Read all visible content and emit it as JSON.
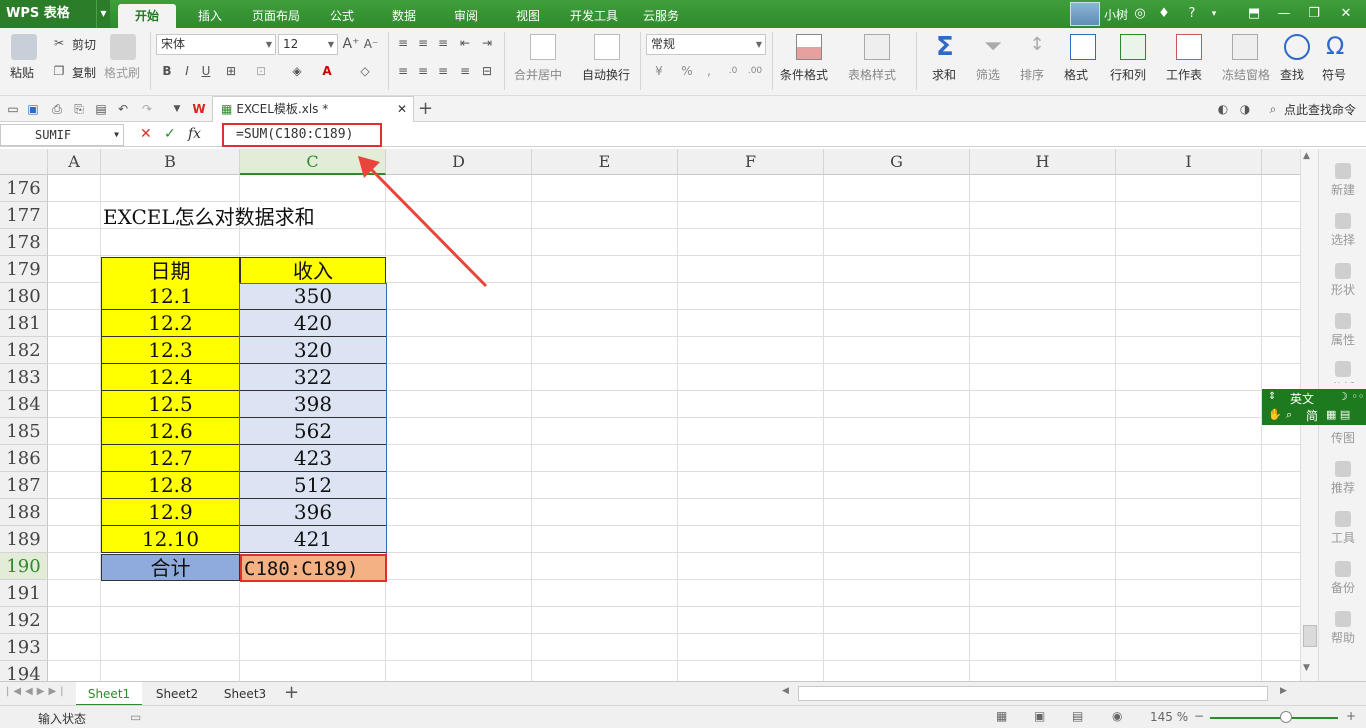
{
  "app": {
    "name": "WPS 表格"
  },
  "menu_tabs": [
    "开始",
    "插入",
    "页面布局",
    "公式",
    "数据",
    "审阅",
    "视图",
    "开发工具",
    "云服务"
  ],
  "user": {
    "name": "小树"
  },
  "ribbon": {
    "paste": "粘贴",
    "cut": "剪切",
    "copy": "复制",
    "format_painter": "格式刷",
    "font_name": "宋体",
    "font_size": "12",
    "merge_center": "合并居中",
    "wrap_text": "自动换行",
    "number_format": "常规",
    "percent": "%",
    "comma": ",",
    "conditional_format": "条件格式",
    "table_style": "表格样式",
    "sum": "求和",
    "filter": "筛选",
    "sort": "排序",
    "format": "格式",
    "rows_cols": "行和列",
    "worksheet": "工作表",
    "freeze": "冻结窗格",
    "find": "查找",
    "symbol": "符号",
    "bold": "B",
    "italic": "I",
    "underline": "U",
    "font_color_letter": "A"
  },
  "doc_tab": {
    "title": "EXCEL模板.xls *"
  },
  "search_cmd": "点此查找命令",
  "formula_bar": {
    "name_box": "SUMIF",
    "cancel": "✕",
    "confirm": "✓",
    "fx": "fx",
    "formula": "=SUM(C180:C189)"
  },
  "columns": [
    "A",
    "B",
    "C",
    "D",
    "E",
    "F",
    "G",
    "H",
    "I"
  ],
  "rows": [
    "176",
    "177",
    "178",
    "179",
    "180",
    "181",
    "182",
    "183",
    "184",
    "185",
    "186",
    "187",
    "188",
    "189",
    "190",
    "191",
    "192",
    "193",
    "194"
  ],
  "sheet": {
    "title": "EXCEL怎么对数据求和",
    "header_date": "日期",
    "header_income": "收入",
    "dates": [
      "12.1",
      "12.2",
      "12.3",
      "12.4",
      "12.5",
      "12.6",
      "12.7",
      "12.8",
      "12.9",
      "12.10"
    ],
    "income": [
      "350",
      "420",
      "320",
      "322",
      "398",
      "562",
      "423",
      "512",
      "396",
      "421"
    ],
    "total_label": "合计",
    "total_edit": "C180:C189)"
  },
  "side_panel": [
    "新建",
    "选择",
    "形状",
    "属性",
    "分析",
    "传图",
    "推荐",
    "工具",
    "备份",
    "帮助"
  ],
  "ime": {
    "lang": "英文",
    "mode": "简"
  },
  "sheet_tabs": [
    "Sheet1",
    "Sheet2",
    "Sheet3"
  ],
  "status": {
    "mode": "输入状态",
    "zoom": "145 %"
  },
  "colors": {
    "accent": "#2d8a2d",
    "highlight_red": "#e0302a",
    "yellow": "#ffff00",
    "lavender": "#dce3f3",
    "blue_total": "#8faadc",
    "orange": "#f4b183"
  }
}
